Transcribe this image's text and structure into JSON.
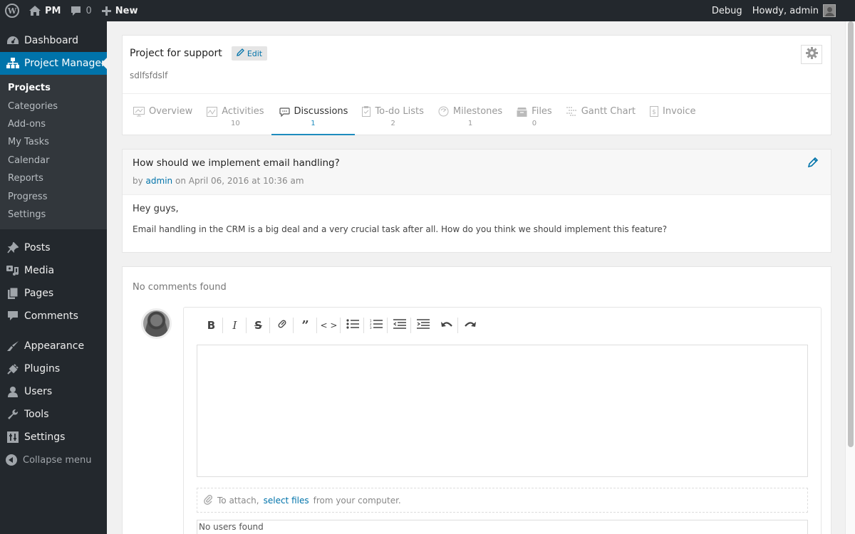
{
  "adminbar": {
    "site_name": "PM",
    "comments_count": "0",
    "new_label": "New",
    "debug_label": "Debug",
    "greeting": "Howdy, admin"
  },
  "sidebar": {
    "dashboard": "Dashboard",
    "project_manager": "Project Manager",
    "submenu": [
      "Projects",
      "Categories",
      "Add-ons",
      "My Tasks",
      "Calendar",
      "Reports",
      "Progress",
      "Settings"
    ],
    "posts": "Posts",
    "media": "Media",
    "pages": "Pages",
    "comments": "Comments",
    "appearance": "Appearance",
    "plugins": "Plugins",
    "users": "Users",
    "tools": "Tools",
    "settings": "Settings",
    "collapse": "Collapse menu"
  },
  "project": {
    "title": "Project for support",
    "edit_label": "Edit",
    "description": "sdlfsfdslf"
  },
  "tabs": [
    {
      "label": "Overview",
      "count": "",
      "icon": "monitor-icon"
    },
    {
      "label": "Activities",
      "count": "10",
      "icon": "activity-chart-icon"
    },
    {
      "label": "Discussions",
      "count": "1",
      "icon": "chat-bubbles-icon",
      "active": true
    },
    {
      "label": "To-do Lists",
      "count": "2",
      "icon": "clipboard-check-icon"
    },
    {
      "label": "Milestones",
      "count": "1",
      "icon": "gauge-icon"
    },
    {
      "label": "Files",
      "count": "0",
      "icon": "archive-box-icon"
    },
    {
      "label": "Gantt Chart",
      "count": "",
      "icon": "gantt-icon"
    },
    {
      "label": "Invoice",
      "count": "",
      "icon": "invoice-icon"
    }
  ],
  "discussion": {
    "title": "How should we implement email handling?",
    "meta_by": "by",
    "author": "admin",
    "meta_date": "on April 06, 2016 at 10:36 am",
    "greeting": "Hey guys,",
    "body": "Email handling in the CRM is a big deal and a very crucial task after all. How do you think we should implement this feature?"
  },
  "comments": {
    "empty_label": "No comments found",
    "toolbar": [
      "bold",
      "italic",
      "strikethrough",
      "link",
      "blockquote",
      "code",
      "bullet-list",
      "numbered-list",
      "outdent",
      "indent",
      "undo",
      "redo"
    ],
    "attach_prefix": "To attach,",
    "attach_link": "select files",
    "attach_suffix": "from your computer.",
    "users_label": "No users found"
  }
}
